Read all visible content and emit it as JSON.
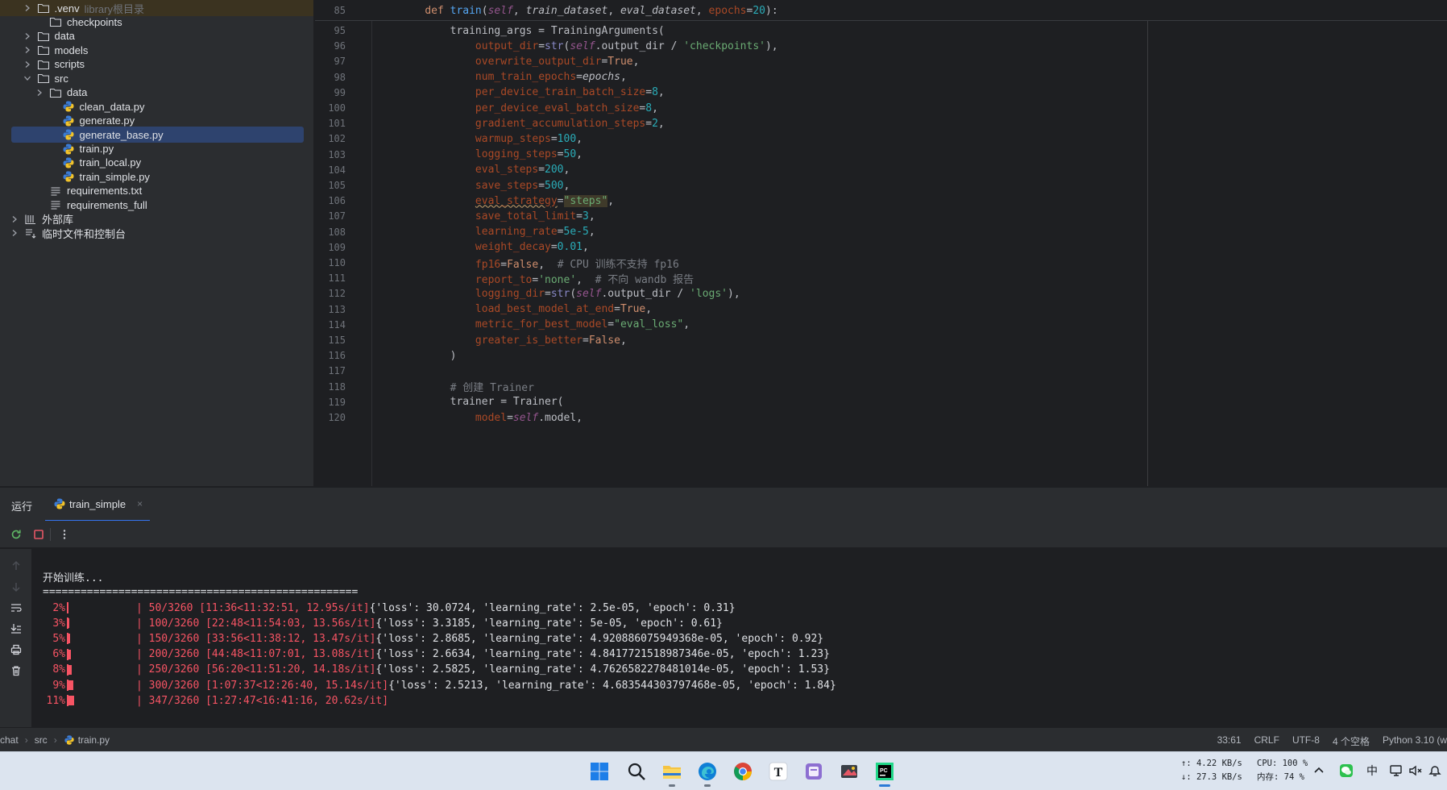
{
  "project_tree": {
    "items": [
      {
        "label": ".venv",
        "extra": "library根目录",
        "kind": "folder",
        "expanded": false
      },
      {
        "label": "checkpoints",
        "kind": "folder",
        "expanded": null
      },
      {
        "label": "data",
        "kind": "folder",
        "expanded": false
      },
      {
        "label": "models",
        "kind": "folder",
        "expanded": false
      },
      {
        "label": "scripts",
        "kind": "folder",
        "expanded": false
      },
      {
        "label": "src",
        "kind": "folder",
        "expanded": true
      },
      {
        "label": "data",
        "kind": "folder",
        "expanded": false
      },
      {
        "label": "clean_data.py",
        "kind": "python"
      },
      {
        "label": "generate.py",
        "kind": "python"
      },
      {
        "label": "generate_base.py",
        "kind": "python",
        "selected": true
      },
      {
        "label": "train.py",
        "kind": "python"
      },
      {
        "label": "train_local.py",
        "kind": "python"
      },
      {
        "label": "train_simple.py",
        "kind": "python"
      },
      {
        "label": "requirements.txt",
        "kind": "text"
      },
      {
        "label": "requirements_full",
        "kind": "text"
      },
      {
        "label": "外部库",
        "kind": "library",
        "expanded": false
      },
      {
        "label": "临时文件和控制台",
        "kind": "scratch",
        "expanded": false
      }
    ]
  },
  "editor": {
    "sticky": {
      "line": "85",
      "text": "    def train(self, train_dataset, eval_dataset, epochs=20):"
    },
    "lines": [
      {
        "n": "95",
        "text": "        training_args = TrainingArguments("
      },
      {
        "n": "96",
        "text": "            output_dir=str(self.output_dir / 'checkpoints'),"
      },
      {
        "n": "97",
        "text": "            overwrite_output_dir=True,"
      },
      {
        "n": "98",
        "text": "            num_train_epochs=epochs,"
      },
      {
        "n": "99",
        "text": "            per_device_train_batch_size=8,"
      },
      {
        "n": "100",
        "text": "            per_device_eval_batch_size=8,"
      },
      {
        "n": "101",
        "text": "            gradient_accumulation_steps=2,"
      },
      {
        "n": "102",
        "text": "            warmup_steps=100,"
      },
      {
        "n": "103",
        "text": "            logging_steps=50,"
      },
      {
        "n": "104",
        "text": "            eval_steps=200,"
      },
      {
        "n": "105",
        "text": "            save_steps=500,"
      },
      {
        "n": "106",
        "text": "            eval_strategy=\"steps\","
      },
      {
        "n": "107",
        "text": "            save_total_limit=3,"
      },
      {
        "n": "108",
        "text": "            learning_rate=5e-5,"
      },
      {
        "n": "109",
        "text": "            weight_decay=0.01,"
      },
      {
        "n": "110",
        "text": "            fp16=False,  # CPU 训练不支持 fp16"
      },
      {
        "n": "111",
        "text": "            report_to='none',  # 不向 wandb 报告"
      },
      {
        "n": "112",
        "text": "            logging_dir=str(self.output_dir / 'logs'),"
      },
      {
        "n": "113",
        "text": "            load_best_model_at_end=True,"
      },
      {
        "n": "114",
        "text": "            metric_for_best_model=\"eval_loss\","
      },
      {
        "n": "115",
        "text": "            greater_is_better=False,"
      },
      {
        "n": "116",
        "text": "        )"
      },
      {
        "n": "117",
        "text": ""
      },
      {
        "n": "118",
        "text": "        # 创建 Trainer"
      },
      {
        "n": "119",
        "text": "        trainer = Trainer("
      },
      {
        "n": "120",
        "text": "            model=self.model,"
      }
    ]
  },
  "run_panel": {
    "label": "运行",
    "tab_label": "train_simple",
    "tab_close": "×",
    "console": {
      "intro": "开始训练...",
      "rule": "==================================================",
      "progress": [
        {
          "pct": "2%",
          "fraction": 0.015,
          "info": "| 50/3260 [11:36<11:32:51, 12.95s/it]",
          "log": "{'loss': 30.0724, 'learning_rate': 2.5e-05, 'epoch': 0.31}"
        },
        {
          "pct": "3%",
          "fraction": 0.031,
          "info": "| 100/3260 [22:48<11:54:03, 13.56s/it]",
          "log": "{'loss': 3.3185, 'learning_rate': 5e-05, 'epoch': 0.61}"
        },
        {
          "pct": "5%",
          "fraction": 0.046,
          "info": "| 150/3260 [33:56<11:38:12, 13.47s/it]",
          "log": "{'loss': 2.8685, 'learning_rate': 4.920886075949368e-05, 'epoch': 0.92}"
        },
        {
          "pct": "6%",
          "fraction": 0.061,
          "info": "| 200/3260 [44:48<11:07:01, 13.08s/it]",
          "log": "{'loss': 2.6634, 'learning_rate': 4.8417721518987346e-05, 'epoch': 1.23}"
        },
        {
          "pct": "8%",
          "fraction": 0.077,
          "info": "| 250/3260 [56:20<11:51:20, 14.18s/it]",
          "log": "{'loss': 2.5825, 'learning_rate': 4.7626582278481014e-05, 'epoch': 1.53}"
        },
        {
          "pct": "9%",
          "fraction": 0.092,
          "info": "| 300/3260 [1:07:37<12:26:40, 15.14s/it]",
          "log": "{'loss': 2.5213, 'learning_rate': 4.683544303797468e-05, 'epoch': 1.84}"
        },
        {
          "pct": "11%",
          "fraction": 0.106,
          "info": "| 347/3260 [1:27:47<16:41:16, 20.62s/it]",
          "log": ""
        }
      ]
    }
  },
  "statusbar": {
    "breadcrumb": [
      "chat",
      "src",
      "train.py"
    ],
    "position": "33:61",
    "line_ending": "CRLF",
    "encoding": "UTF-8",
    "indent": "4 个空格",
    "interpreter": "Python 3.10 (w"
  },
  "taskbar": {
    "net_up": "↑: 4.22 KB/s",
    "net_down": "↓: 27.3 KB/s",
    "cpu": "CPU: 100 %",
    "mem": "内存: 74 %",
    "ime": "中",
    "icons": [
      "windows-start",
      "search",
      "file-explorer",
      "edge",
      "chrome",
      "typora",
      "notes-app",
      "snipping-tool",
      "pycharm"
    ]
  },
  "colors": {
    "accent": "#3574f0",
    "progress": "#f75464",
    "selection": "#2e436e"
  }
}
